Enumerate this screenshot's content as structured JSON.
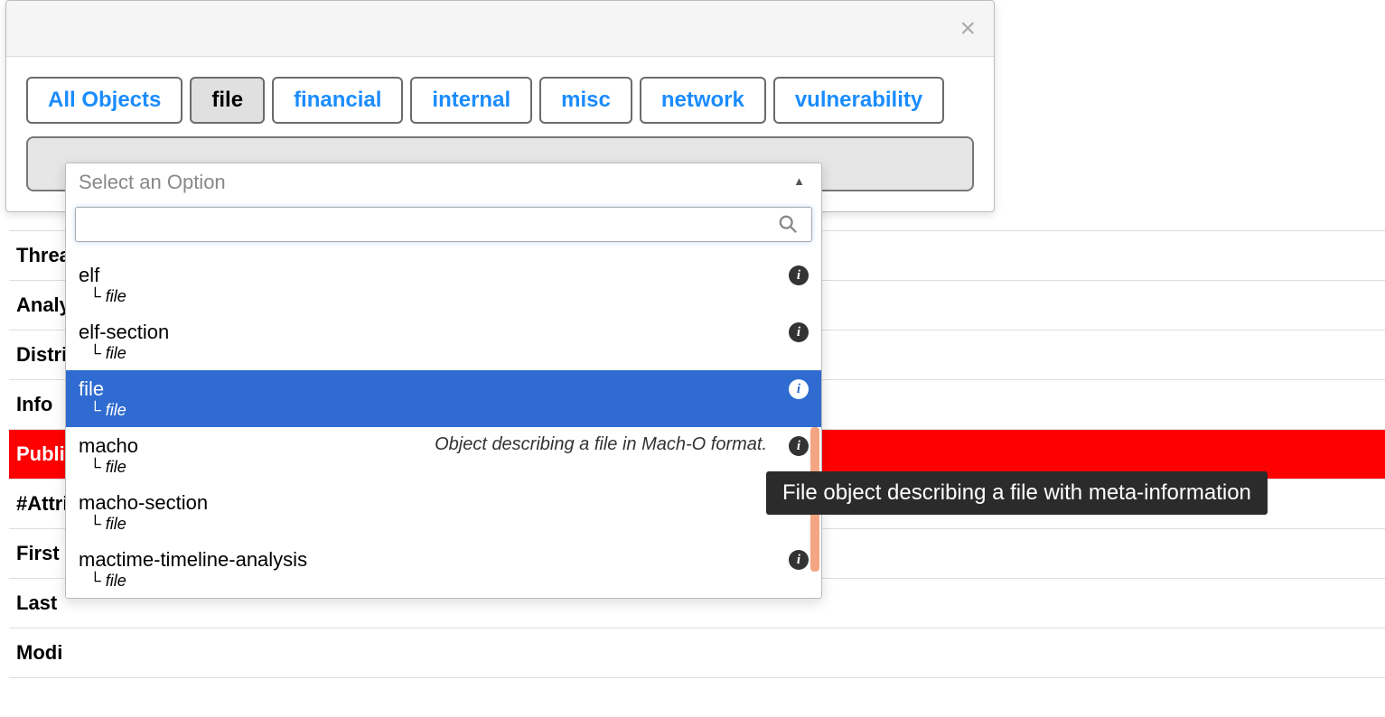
{
  "modal": {
    "close_label": "×"
  },
  "tabs": [
    {
      "label": "All Objects",
      "active": false,
      "name": "tab-all-objects"
    },
    {
      "label": "file",
      "active": true,
      "name": "tab-file"
    },
    {
      "label": "financial",
      "active": false,
      "name": "tab-financial"
    },
    {
      "label": "internal",
      "active": false,
      "name": "tab-internal"
    },
    {
      "label": "misc",
      "active": false,
      "name": "tab-misc"
    },
    {
      "label": "network",
      "active": false,
      "name": "tab-network"
    },
    {
      "label": "vulnerability",
      "active": false,
      "name": "tab-vulnerability"
    }
  ],
  "dropdown": {
    "placeholder": "Select an Option",
    "search_value": "",
    "options": [
      {
        "title": "elf",
        "sub": "file",
        "desc": "",
        "highlight": false
      },
      {
        "title": "elf-section",
        "sub": "file",
        "desc": "",
        "highlight": false
      },
      {
        "title": "file",
        "sub": "file",
        "desc": "",
        "highlight": true
      },
      {
        "title": "macho",
        "sub": "file",
        "desc": "Object describing a file in Mach-O format.",
        "highlight": false
      },
      {
        "title": "macho-section",
        "sub": "file",
        "desc": "",
        "highlight": false
      },
      {
        "title": "mactime-timeline-analysis",
        "sub": "file",
        "desc": "",
        "highlight": false
      }
    ]
  },
  "tooltip": {
    "text": "File object describing a file with meta-information"
  },
  "bg_rows": [
    {
      "label": "Threa",
      "red": false
    },
    {
      "label": "Analy",
      "red": false
    },
    {
      "label": "Distri",
      "red": false
    },
    {
      "label": "Info",
      "red": false
    },
    {
      "label": "Publi",
      "red": true
    },
    {
      "label": "#Attri",
      "red": false
    },
    {
      "label": "First",
      "red": false
    },
    {
      "label": "Last",
      "red": false
    },
    {
      "label": "Modi",
      "red": false
    }
  ]
}
